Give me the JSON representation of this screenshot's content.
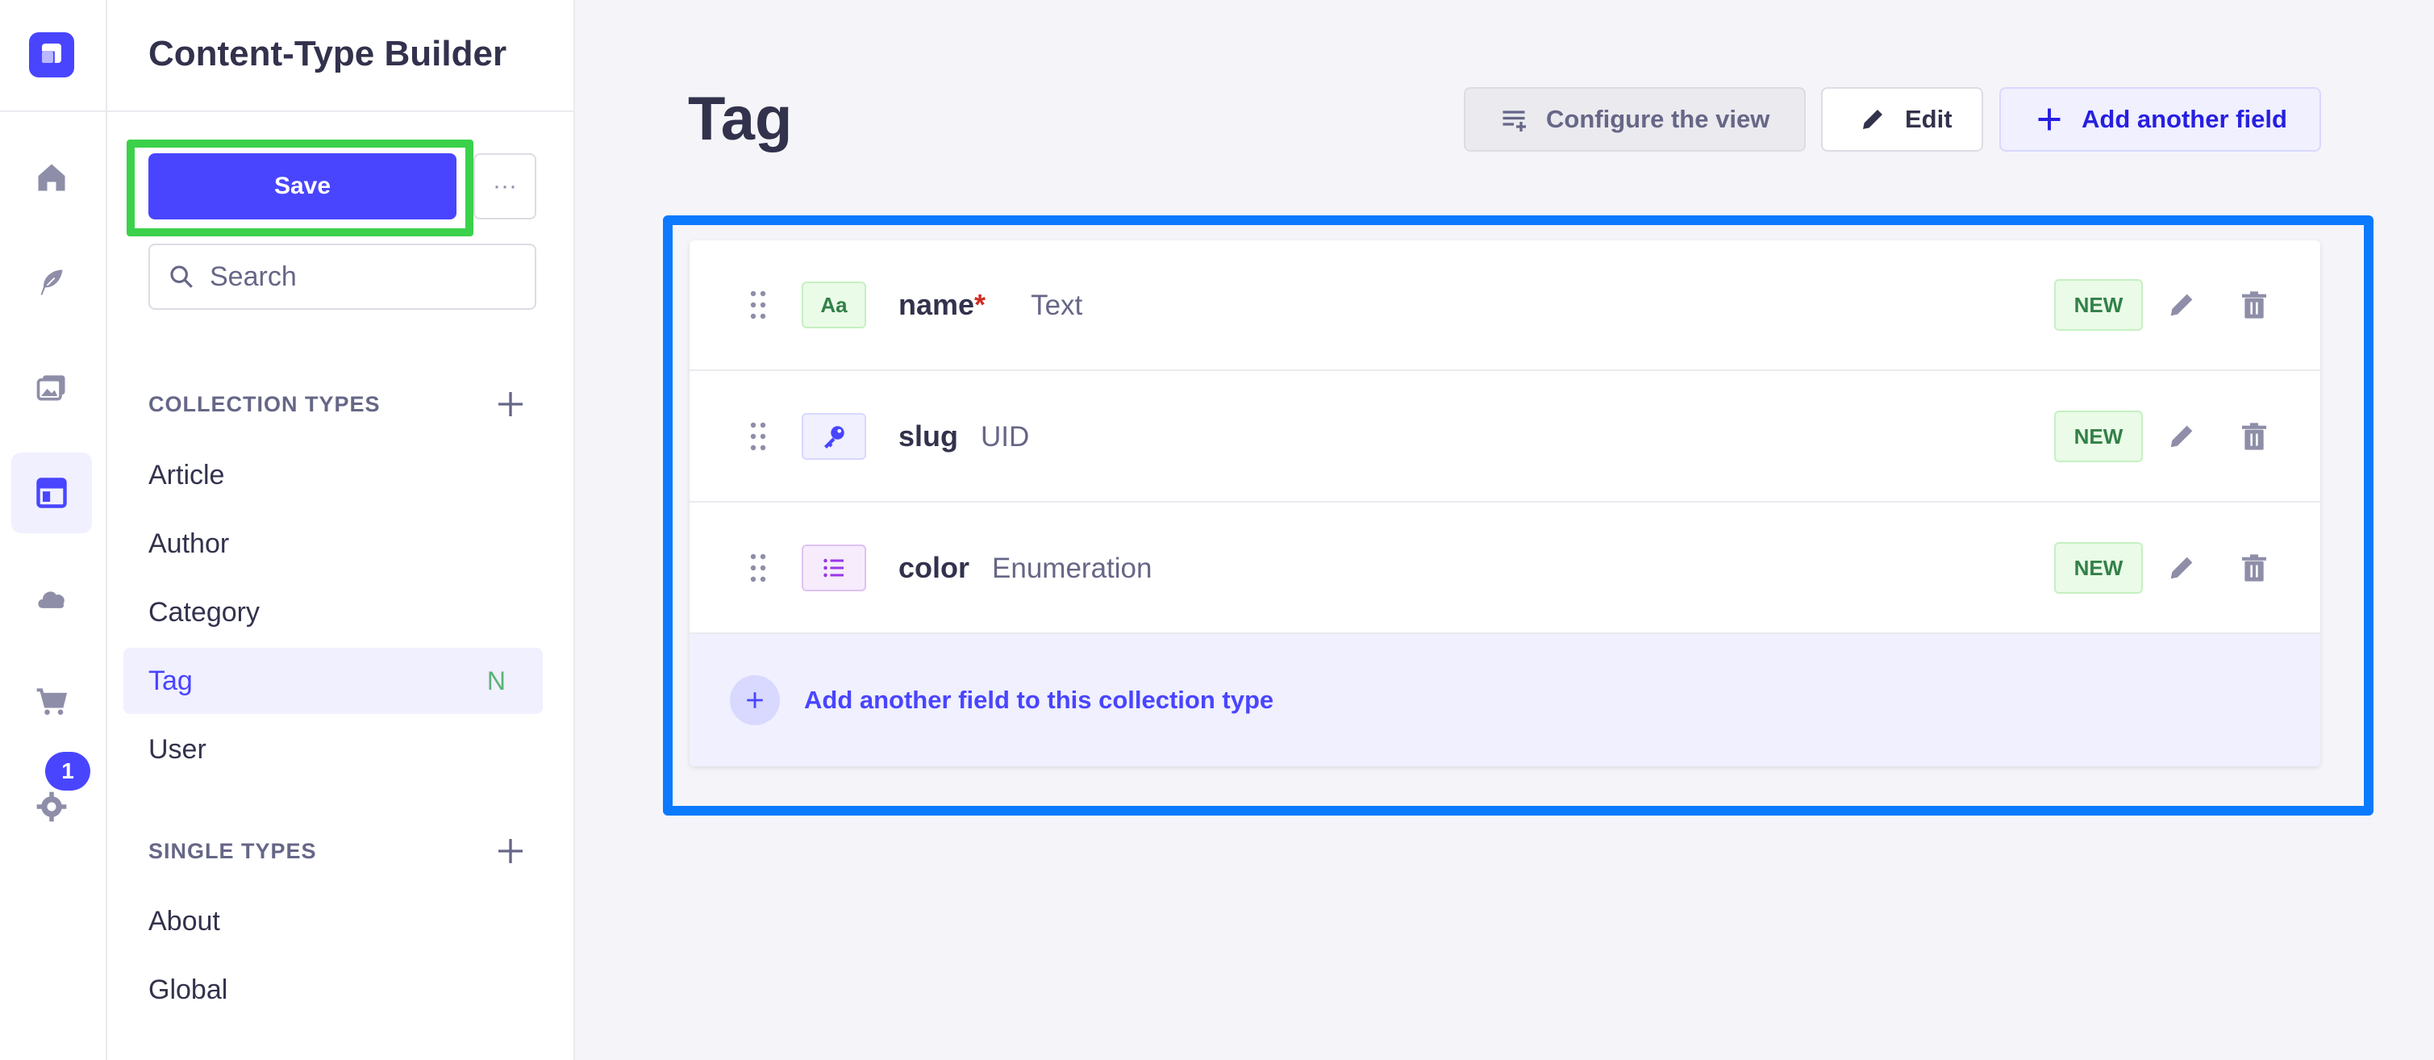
{
  "sidebar": {
    "title": "Content-Type Builder",
    "save_label": "Save",
    "more_label": "···",
    "search_placeholder": "Search",
    "collection_types_heading": "COLLECTION TYPES",
    "collection_types": [
      {
        "label": "Article",
        "badge": ""
      },
      {
        "label": "Author",
        "badge": ""
      },
      {
        "label": "Category",
        "badge": ""
      },
      {
        "label": "Tag",
        "badge": "N"
      },
      {
        "label": "User",
        "badge": ""
      }
    ],
    "single_types_heading": "SINGLE TYPES",
    "single_types": [
      {
        "label": "About"
      },
      {
        "label": "Global"
      }
    ]
  },
  "rail": {
    "settings_badge": "1",
    "icons": [
      "home-icon",
      "feather-icon",
      "media-library-icon",
      "layout-icon",
      "cloud-icon",
      "cart-icon",
      "settings-icon"
    ]
  },
  "header": {
    "title": "Tag",
    "configure_label": "Configure the view",
    "edit_label": "Edit",
    "add_label": "Add another field"
  },
  "fields": [
    {
      "name": "name",
      "required": "*",
      "type": "Text",
      "icon": "text-type-icon",
      "icon_text": "Aa",
      "badge": "NEW"
    },
    {
      "name": "slug",
      "required": "",
      "type": "UID",
      "icon": "key-icon",
      "badge": "NEW"
    },
    {
      "name": "color",
      "required": "",
      "type": "Enumeration",
      "icon": "list-icon",
      "badge": "NEW"
    }
  ],
  "add_field_label": "Add another field to this collection type",
  "colors": {
    "primary": "#4945ff",
    "save_highlight": "#3bd14a",
    "fields_highlight": "#0b7aff",
    "new_badge": "#328048"
  }
}
